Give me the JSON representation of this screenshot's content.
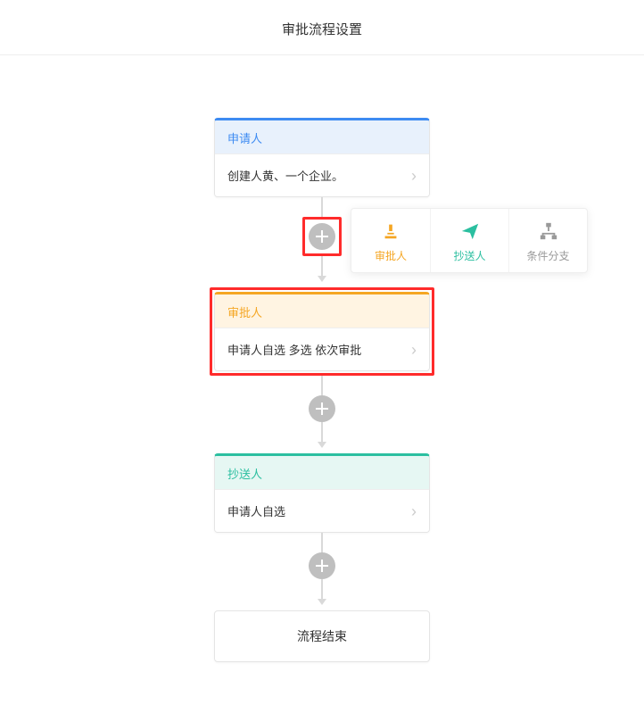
{
  "page": {
    "title": "审批流程设置"
  },
  "nodes": {
    "applicant": {
      "title": "申请人",
      "body": "创建人黄、一个企业。"
    },
    "approver": {
      "title": "审批人",
      "body": "申请人自选 多选 依次审批"
    },
    "cc": {
      "title": "抄送人",
      "body": "申请人自选"
    },
    "end": {
      "label": "流程结束"
    }
  },
  "popover": {
    "approver": "审批人",
    "cc": "抄送人",
    "branch": "条件分支"
  },
  "colors": {
    "applicant": "#3d8bf2",
    "approver": "#f5a623",
    "cc": "#2bbfa0",
    "highlight": "#ff2b2b"
  }
}
